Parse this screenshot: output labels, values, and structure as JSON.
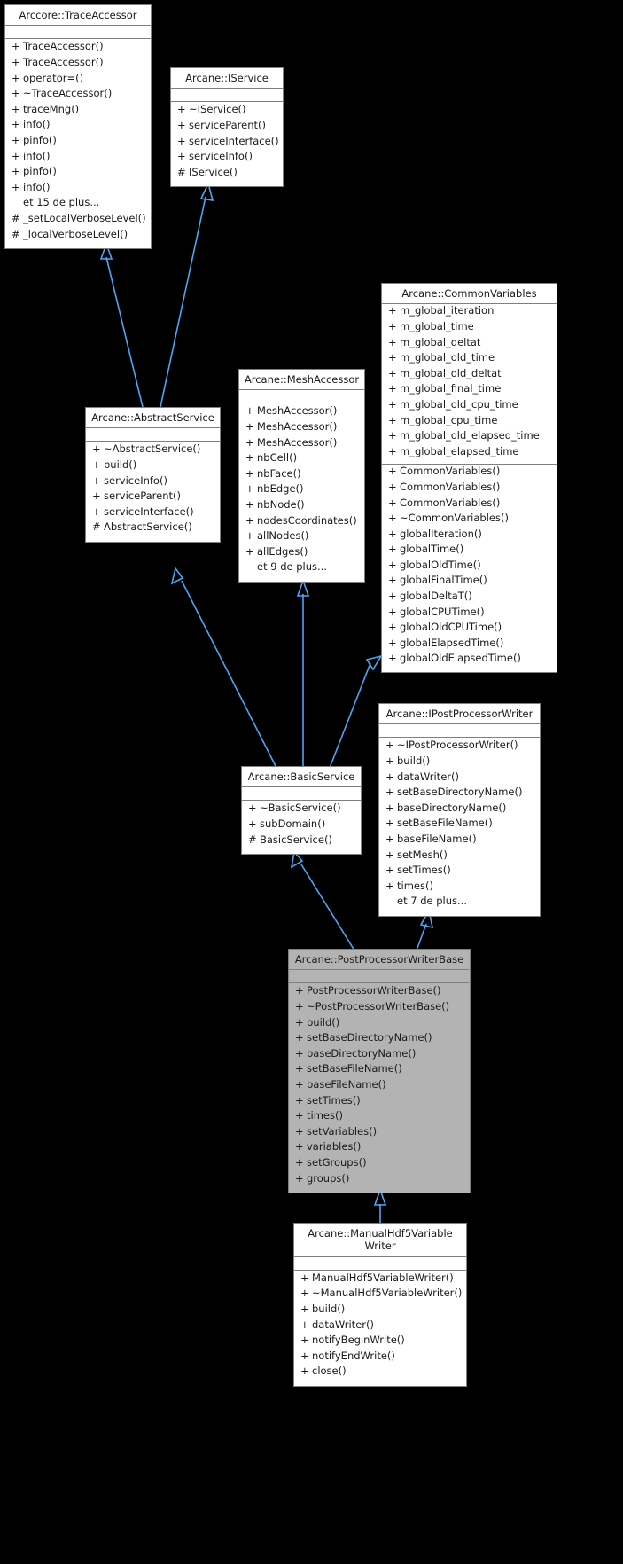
{
  "diagram": {
    "type": "uml-inheritance-graph",
    "background_color": "#000000",
    "box_fill": "#ffffff",
    "box_highlight_fill": "#b3b3b3",
    "box_border": "#808080",
    "edge_color": "#4ba6f5",
    "text_color": "#1a1a1a"
  },
  "classes": [
    {
      "id": "trace-accessor",
      "title": "Arccore::TraceAccessor",
      "highlight": false,
      "has_attr_compartment": true,
      "attributes": [],
      "methods": [
        {
          "vis": "+",
          "name": "TraceAccessor()"
        },
        {
          "vis": "+",
          "name": "TraceAccessor()"
        },
        {
          "vis": "+",
          "name": "operator=()"
        },
        {
          "vis": "+",
          "name": "~TraceAccessor()"
        },
        {
          "vis": "+",
          "name": "traceMng()"
        },
        {
          "vis": "+",
          "name": "info()"
        },
        {
          "vis": "+",
          "name": "pinfo()"
        },
        {
          "vis": "+",
          "name": "info()"
        },
        {
          "vis": "+",
          "name": "pinfo()"
        },
        {
          "vis": "+",
          "name": "info()"
        },
        {
          "vis": "",
          "name": "et 15 de plus..."
        },
        {
          "vis": "#",
          "name": "_setLocalVerboseLevel()"
        },
        {
          "vis": "#",
          "name": "_localVerboseLevel()"
        }
      ]
    },
    {
      "id": "iservice",
      "title": "Arcane::IService",
      "highlight": false,
      "has_attr_compartment": true,
      "attributes": [],
      "methods": [
        {
          "vis": "+",
          "name": "~IService()"
        },
        {
          "vis": "+",
          "name": "serviceParent()"
        },
        {
          "vis": "+",
          "name": "serviceInterface()"
        },
        {
          "vis": "+",
          "name": "serviceInfo()"
        },
        {
          "vis": "#",
          "name": "IService()"
        }
      ]
    },
    {
      "id": "abstract-service",
      "title": "Arcane::AbstractService",
      "highlight": false,
      "has_attr_compartment": true,
      "attributes": [],
      "methods": [
        {
          "vis": "+",
          "name": "~AbstractService()"
        },
        {
          "vis": "+",
          "name": "build()"
        },
        {
          "vis": "+",
          "name": "serviceInfo()"
        },
        {
          "vis": "+",
          "name": "serviceParent()"
        },
        {
          "vis": "+",
          "name": "serviceInterface()"
        },
        {
          "vis": "#",
          "name": "AbstractService()"
        }
      ]
    },
    {
      "id": "mesh-accessor",
      "title": "Arcane::MeshAccessor",
      "highlight": false,
      "has_attr_compartment": true,
      "attributes": [],
      "methods": [
        {
          "vis": "+",
          "name": "MeshAccessor()"
        },
        {
          "vis": "+",
          "name": "MeshAccessor()"
        },
        {
          "vis": "+",
          "name": "MeshAccessor()"
        },
        {
          "vis": "+",
          "name": "nbCell()"
        },
        {
          "vis": "+",
          "name": "nbFace()"
        },
        {
          "vis": "+",
          "name": "nbEdge()"
        },
        {
          "vis": "+",
          "name": "nbNode()"
        },
        {
          "vis": "+",
          "name": "nodesCoordinates()"
        },
        {
          "vis": "+",
          "name": "allNodes()"
        },
        {
          "vis": "+",
          "name": "allEdges()"
        },
        {
          "vis": "",
          "name": "et 9 de plus..."
        }
      ]
    },
    {
      "id": "common-variables",
      "title": "Arcane::CommonVariables",
      "highlight": false,
      "has_attr_compartment": false,
      "attributes": [
        {
          "vis": "+",
          "name": "m_global_iteration"
        },
        {
          "vis": "+",
          "name": "m_global_time"
        },
        {
          "vis": "+",
          "name": "m_global_deltat"
        },
        {
          "vis": "+",
          "name": "m_global_old_time"
        },
        {
          "vis": "+",
          "name": "m_global_old_deltat"
        },
        {
          "vis": "+",
          "name": "m_global_final_time"
        },
        {
          "vis": "+",
          "name": "m_global_old_cpu_time"
        },
        {
          "vis": "+",
          "name": "m_global_cpu_time"
        },
        {
          "vis": "+",
          "name": "m_global_old_elapsed_time"
        },
        {
          "vis": "+",
          "name": "m_global_elapsed_time"
        }
      ],
      "methods": [
        {
          "vis": "+",
          "name": "CommonVariables()"
        },
        {
          "vis": "+",
          "name": "CommonVariables()"
        },
        {
          "vis": "+",
          "name": "CommonVariables()"
        },
        {
          "vis": "+",
          "name": "~CommonVariables()"
        },
        {
          "vis": "+",
          "name": "globalIteration()"
        },
        {
          "vis": "+",
          "name": "globalTime()"
        },
        {
          "vis": "+",
          "name": "globalOldTime()"
        },
        {
          "vis": "+",
          "name": "globalFinalTime()"
        },
        {
          "vis": "+",
          "name": "globalDeltaT()"
        },
        {
          "vis": "+",
          "name": "globalCPUTime()"
        },
        {
          "vis": "+",
          "name": "globalOldCPUTime()"
        },
        {
          "vis": "+",
          "name": "globalElapsedTime()"
        },
        {
          "vis": "+",
          "name": "globalOldElapsedTime()"
        }
      ]
    },
    {
      "id": "basic-service",
      "title": "Arcane::BasicService",
      "highlight": false,
      "has_attr_compartment": true,
      "attributes": [],
      "methods": [
        {
          "vis": "+",
          "name": "~BasicService()"
        },
        {
          "vis": "+",
          "name": "subDomain()"
        },
        {
          "vis": "#",
          "name": "BasicService()"
        }
      ]
    },
    {
      "id": "ipostprocessor-writer",
      "title": "Arcane::IPostProcessorWriter",
      "highlight": false,
      "has_attr_compartment": true,
      "attributes": [],
      "methods": [
        {
          "vis": "+",
          "name": "~IPostProcessorWriter()"
        },
        {
          "vis": "+",
          "name": "build()"
        },
        {
          "vis": "+",
          "name": "dataWriter()"
        },
        {
          "vis": "+",
          "name": "setBaseDirectoryName()"
        },
        {
          "vis": "+",
          "name": "baseDirectoryName()"
        },
        {
          "vis": "+",
          "name": "setBaseFileName()"
        },
        {
          "vis": "+",
          "name": "baseFileName()"
        },
        {
          "vis": "+",
          "name": "setMesh()"
        },
        {
          "vis": "+",
          "name": "setTimes()"
        },
        {
          "vis": "+",
          "name": "times()"
        },
        {
          "vis": "",
          "name": "et 7 de plus..."
        }
      ]
    },
    {
      "id": "postprocessor-writer-base",
      "title": "Arcane::PostProcessorWriterBase",
      "highlight": true,
      "has_attr_compartment": true,
      "attributes": [],
      "methods": [
        {
          "vis": "+",
          "name": "PostProcessorWriterBase()"
        },
        {
          "vis": "+",
          "name": "~PostProcessorWriterBase()"
        },
        {
          "vis": "+",
          "name": "build()"
        },
        {
          "vis": "+",
          "name": "setBaseDirectoryName()"
        },
        {
          "vis": "+",
          "name": "baseDirectoryName()"
        },
        {
          "vis": "+",
          "name": "setBaseFileName()"
        },
        {
          "vis": "+",
          "name": "baseFileName()"
        },
        {
          "vis": "+",
          "name": "setTimes()"
        },
        {
          "vis": "+",
          "name": "times()"
        },
        {
          "vis": "+",
          "name": "setVariables()"
        },
        {
          "vis": "+",
          "name": "variables()"
        },
        {
          "vis": "+",
          "name": "setGroups()"
        },
        {
          "vis": "+",
          "name": "groups()"
        }
      ]
    },
    {
      "id": "manual-hdf5-variable-writer",
      "title": "Arcane::ManualHdf5Variable\nWriter",
      "highlight": false,
      "has_attr_compartment": true,
      "attributes": [],
      "methods": [
        {
          "vis": "+",
          "name": "ManualHdf5VariableWriter()"
        },
        {
          "vis": "+",
          "name": "~ManualHdf5VariableWriter()"
        },
        {
          "vis": "+",
          "name": "build()"
        },
        {
          "vis": "+",
          "name": "dataWriter()"
        },
        {
          "vis": "+",
          "name": "notifyBeginWrite()"
        },
        {
          "vis": "+",
          "name": "notifyEndWrite()"
        },
        {
          "vis": "+",
          "name": "close()"
        }
      ]
    }
  ],
  "edges": [
    {
      "from": "abstract-service",
      "to": "trace-accessor",
      "kind": "inheritance"
    },
    {
      "from": "abstract-service",
      "to": "iservice",
      "kind": "inheritance"
    },
    {
      "from": "basic-service",
      "to": "abstract-service",
      "kind": "inheritance"
    },
    {
      "from": "basic-service",
      "to": "mesh-accessor",
      "kind": "inheritance"
    },
    {
      "from": "basic-service",
      "to": "common-variables",
      "kind": "inheritance"
    },
    {
      "from": "postprocessor-writer-base",
      "to": "basic-service",
      "kind": "inheritance"
    },
    {
      "from": "postprocessor-writer-base",
      "to": "ipostprocessor-writer",
      "kind": "inheritance"
    },
    {
      "from": "manual-hdf5-variable-writer",
      "to": "postprocessor-writer-base",
      "kind": "inheritance"
    }
  ]
}
